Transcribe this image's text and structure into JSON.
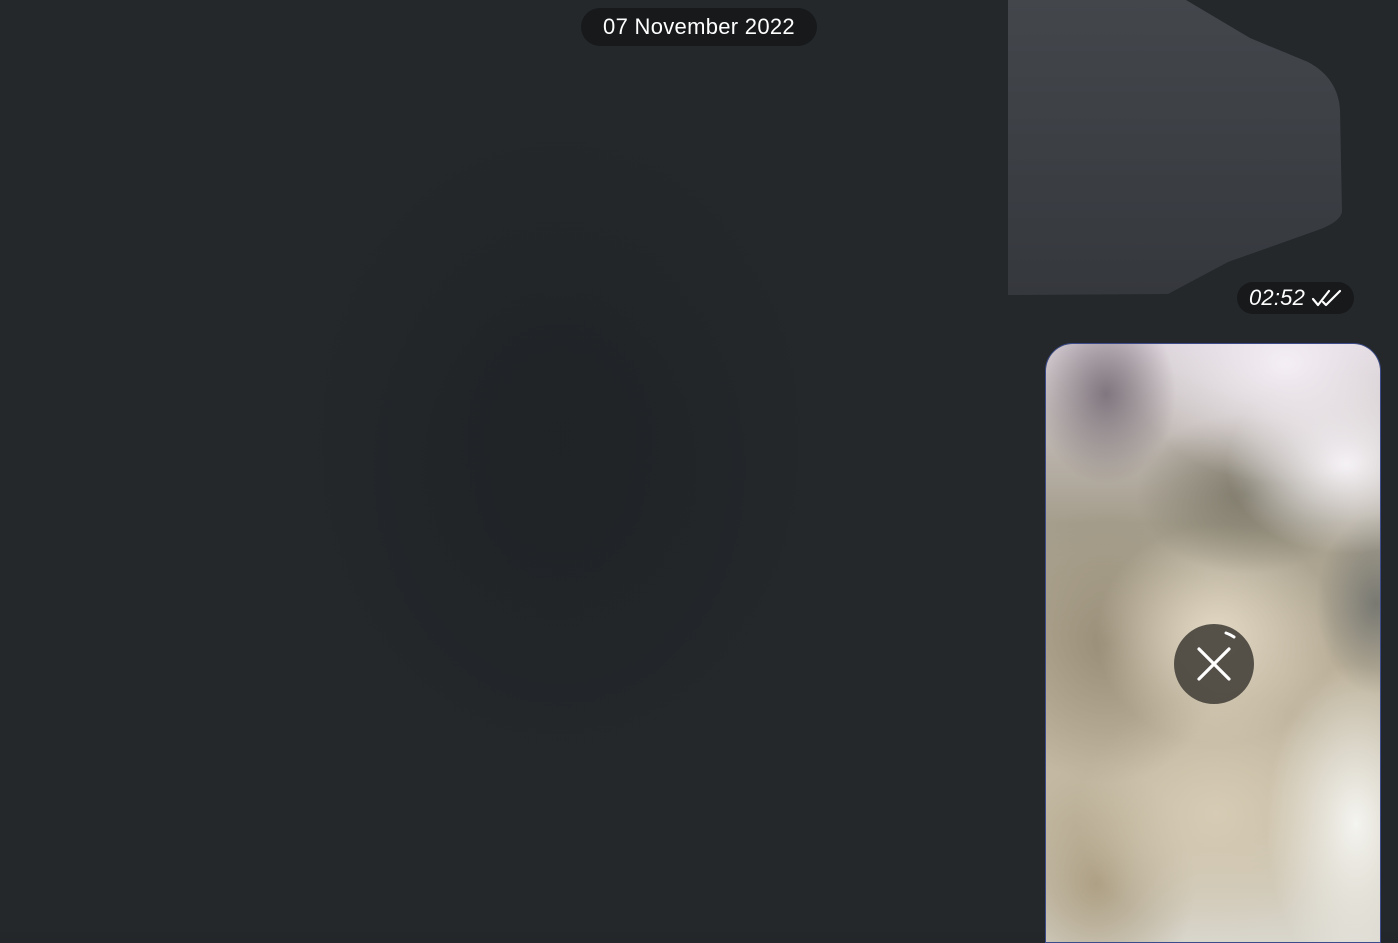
{
  "chat": {
    "date_separator": "07 November 2022",
    "messages": [
      {
        "type": "sticker",
        "time": "02:52",
        "status_icon": "double-check-icon"
      },
      {
        "type": "media",
        "state": "downloading",
        "action_icon": "close-icon"
      }
    ]
  },
  "colors": {
    "background": "#24282b",
    "pill_background": "#17191b",
    "text": "#ffffff",
    "bubble_border": "#3c4b8a"
  }
}
